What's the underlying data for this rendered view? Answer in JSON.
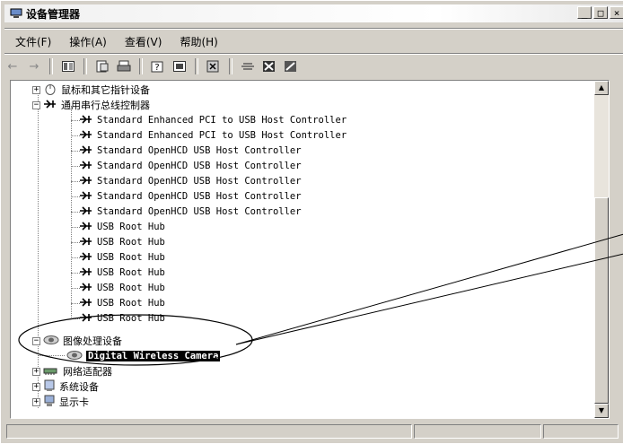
{
  "window": {
    "title": "设备管理器",
    "buttons": [
      "_",
      "□",
      "×"
    ]
  },
  "menu": [
    {
      "label": "文件(F)"
    },
    {
      "label": "操作(A)"
    },
    {
      "label": "查看(V)"
    },
    {
      "label": "帮助(H)"
    }
  ],
  "toolbar": [
    "back-arrow-icon",
    "forward-arrow-icon",
    "properties-view-icon",
    "properties-icon",
    "print-icon",
    "help-icon",
    "view-icon",
    "scan-icon",
    "update-driver-icon",
    "uninstall-icon",
    "disable-icon"
  ],
  "tree": {
    "mice_category": "鼠标和其它指针设备",
    "usb_category": "通用串行总线控制器",
    "usb_items": [
      "Standard Enhanced PCI to USB Host Controller",
      "Standard Enhanced PCI to USB Host Controller",
      "Standard OpenHCD USB Host Controller",
      "Standard OpenHCD USB Host Controller",
      "Standard OpenHCD USB Host Controller",
      "Standard OpenHCD USB Host Controller",
      "Standard OpenHCD USB Host Controller",
      "USB Root Hub",
      "USB Root Hub",
      "USB Root Hub",
      "USB Root Hub",
      "USB Root Hub",
      "USB Root Hub",
      "USB Root Hub"
    ],
    "imaging_category": "图像处理设备",
    "imaging_device": "Digital Wireless Camera",
    "network_category": "网络适配器",
    "system_category": "系统设备",
    "display_category": "显示卡"
  }
}
